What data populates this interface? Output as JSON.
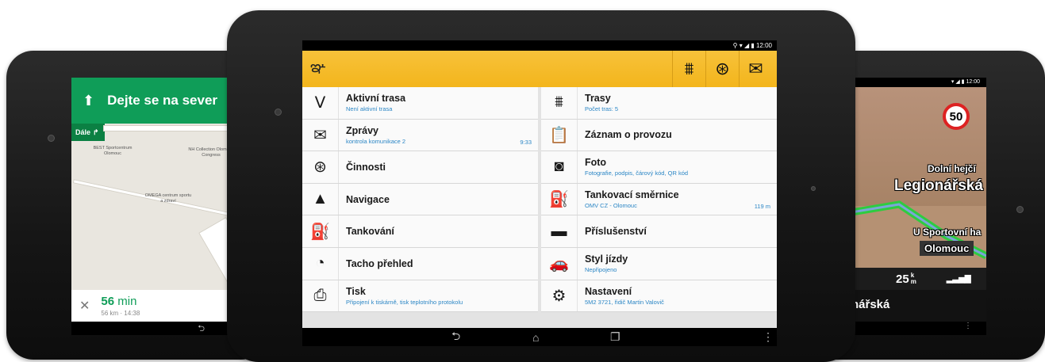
{
  "left_device": {
    "instruction": "Dejte se na sever",
    "next_label": "Dále",
    "map_labels": [
      "BEST Sportcentrum Olomouc",
      "NH Collection Olomouc Congress",
      "OMEGA centrum sportu a zdraví"
    ],
    "eta_minutes": "56",
    "eta_unit": "min",
    "eta_sub": "56 km · 14:38"
  },
  "right_device": {
    "status_time": "12:00",
    "speed_limit": "50",
    "street_top": "Dolní hejčí",
    "street_main": "Legionářská",
    "street_sport": "U Sportovní ha",
    "city": "Olomouc",
    "distance": "25",
    "distance_unit_top": "k",
    "distance_unit_bottom": "m",
    "current_street": "nářská"
  },
  "center_device": {
    "status_time": "12:00",
    "left_items": [
      {
        "icon": "route-icon",
        "title": "Aktivní trasa",
        "subtitle": "Není aktivní trasa",
        "meta": ""
      },
      {
        "icon": "messages-icon",
        "title": "Zprávy",
        "subtitle": "kontrola komunikace 2",
        "meta": "9:33"
      },
      {
        "icon": "steering-wheel-icon",
        "title": "Činnosti",
        "subtitle": "",
        "meta": ""
      },
      {
        "icon": "navigation-icon",
        "title": "Navigace",
        "subtitle": "",
        "meta": ""
      },
      {
        "icon": "fuel-nozzle-icon",
        "title": "Tankování",
        "subtitle": "",
        "meta": ""
      },
      {
        "icon": "tachometer-icon",
        "title": "Tacho přehled",
        "subtitle": "",
        "meta": ""
      },
      {
        "icon": "printer-icon",
        "title": "Tisk",
        "subtitle": "Připojení k tiskárně, tisk teplotního protokolu",
        "meta": ""
      }
    ],
    "right_items": [
      {
        "icon": "routes-icon",
        "title": "Trasy",
        "subtitle": "Počet tras: 5",
        "meta": ""
      },
      {
        "icon": "clipboard-icon",
        "title": "Záznam o provozu",
        "subtitle": "",
        "meta": ""
      },
      {
        "icon": "camera-icon",
        "title": "Foto",
        "subtitle": "Fotografie, podpis, čárový kód, QR kód",
        "meta": ""
      },
      {
        "icon": "fuel-station-icon",
        "title": "Tankovací směrnice",
        "subtitle": "OMV CZ - Olomouc",
        "meta": "119 m"
      },
      {
        "icon": "trailer-icon",
        "title": "Příslušenství",
        "subtitle": "",
        "meta": ""
      },
      {
        "icon": "car-icon",
        "title": "Styl jízdy",
        "subtitle": "Nepřipojeno",
        "meta": ""
      },
      {
        "icon": "settings-icon",
        "title": "Nastavení",
        "subtitle": "5M2 3721, řidič Martin Valovič",
        "meta": ""
      }
    ]
  },
  "colors": {
    "appbar": "#f3b51c",
    "accent_link": "#2b86c5",
    "maps_green": "#0f9d58"
  }
}
